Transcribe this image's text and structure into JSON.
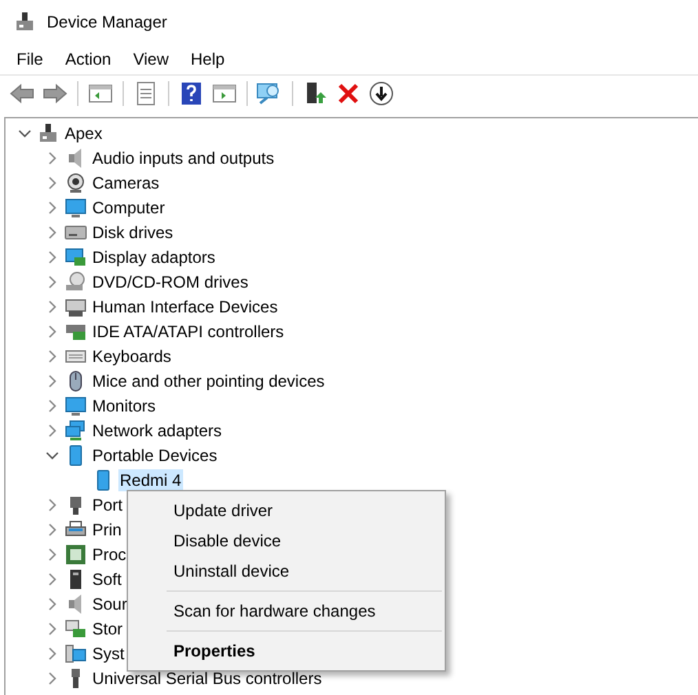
{
  "window": {
    "title": "Device Manager"
  },
  "menu_bar": [
    "File",
    "Action",
    "View",
    "Help"
  ],
  "tree": {
    "label": "Apex",
    "expanded": true,
    "selected": false,
    "children": [
      {
        "label": "Audio inputs and outputs",
        "expanded": false,
        "selected": false
      },
      {
        "label": "Cameras",
        "expanded": false,
        "selected": false
      },
      {
        "label": "Computer",
        "expanded": false,
        "selected": false
      },
      {
        "label": "Disk drives",
        "expanded": false,
        "selected": false
      },
      {
        "label": "Display adaptors",
        "expanded": false,
        "selected": false
      },
      {
        "label": "DVD/CD-ROM drives",
        "expanded": false,
        "selected": false
      },
      {
        "label": "Human Interface Devices",
        "expanded": false,
        "selected": false
      },
      {
        "label": "IDE ATA/ATAPI controllers",
        "expanded": false,
        "selected": false
      },
      {
        "label": "Keyboards",
        "expanded": false,
        "selected": false
      },
      {
        "label": "Mice and other pointing devices",
        "expanded": false,
        "selected": false
      },
      {
        "label": "Monitors",
        "expanded": false,
        "selected": false
      },
      {
        "label": "Network adapters",
        "expanded": false,
        "selected": false
      },
      {
        "label": "Portable Devices",
        "expanded": true,
        "selected": false,
        "children": [
          {
            "label": "Redmi 4",
            "selected": true
          }
        ]
      },
      {
        "label": "Port",
        "expanded": false,
        "selected": false
      },
      {
        "label": "Prin",
        "expanded": false,
        "selected": false
      },
      {
        "label": "Proc",
        "expanded": false,
        "selected": false
      },
      {
        "label": "Soft",
        "expanded": false,
        "selected": false
      },
      {
        "label": "Sour",
        "expanded": false,
        "selected": false
      },
      {
        "label": "Stor",
        "expanded": false,
        "selected": false
      },
      {
        "label": "Syst",
        "expanded": false,
        "selected": false
      },
      {
        "label": "Universal Serial Bus controllers",
        "expanded": false,
        "selected": false
      }
    ]
  },
  "context_menu": [
    {
      "kind": "command",
      "label": "Update driver"
    },
    {
      "kind": "command",
      "label": "Disable device"
    },
    {
      "kind": "command",
      "label": "Uninstall device"
    },
    {
      "kind": "separator"
    },
    {
      "kind": "command",
      "label": "Scan for hardware changes"
    },
    {
      "kind": "separator"
    },
    {
      "kind": "default",
      "label": "Properties"
    }
  ]
}
